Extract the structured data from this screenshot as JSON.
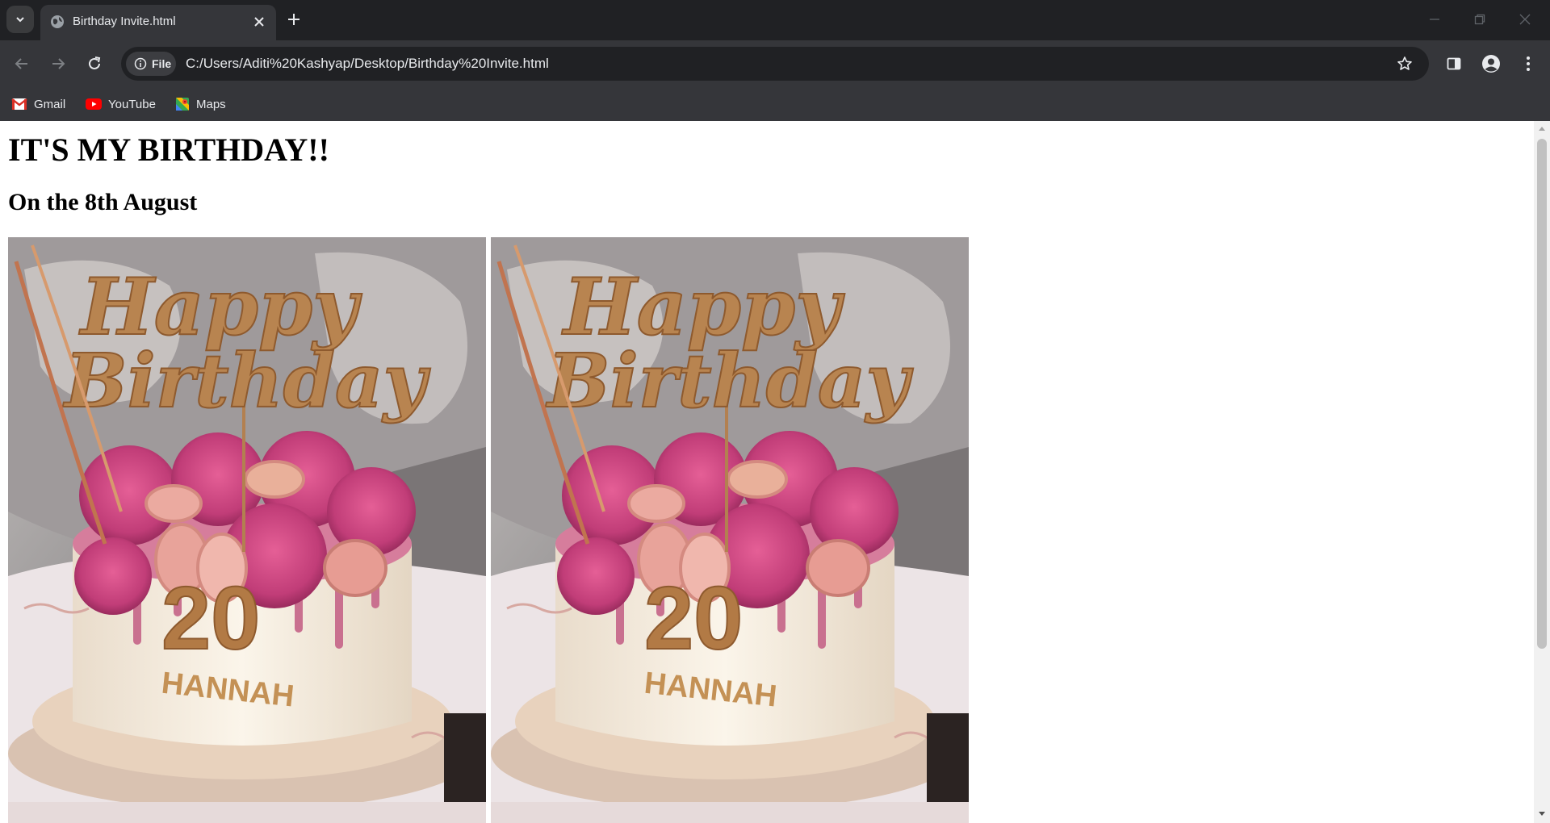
{
  "browser": {
    "tab": {
      "title": "Birthday Invite.html",
      "favicon": "globe-icon"
    },
    "omnibox": {
      "chip_label": "File",
      "url": "C:/Users/Aditi%20Kashyap/Desktop/Birthday%20Invite.html"
    },
    "bookmarks": [
      {
        "label": "Gmail",
        "icon": "gmail-icon"
      },
      {
        "label": "YouTube",
        "icon": "youtube-icon"
      },
      {
        "label": "Maps",
        "icon": "maps-icon"
      }
    ]
  },
  "page": {
    "title": "IT'S MY BIRTHDAY!!",
    "subtitle": "On the 8th August",
    "images": [
      {
        "description_icon": "birthday-cake-photo",
        "topper_text": "Happy Birthday",
        "cake_number": "20",
        "cake_name": "HANNAH"
      },
      {
        "description_icon": "birthday-cake-photo",
        "topper_text": "Happy Birthday",
        "cake_number": "20",
        "cake_name": "HANNAH"
      }
    ]
  },
  "colors": {
    "chrome_dark": "#202124",
    "chrome_toolbar": "#35363a",
    "chrome_text": "#e8eaed",
    "page_bg": "#ffffff",
    "cake_gold": "#b27a45",
    "rose_pink": "#d24f86"
  }
}
